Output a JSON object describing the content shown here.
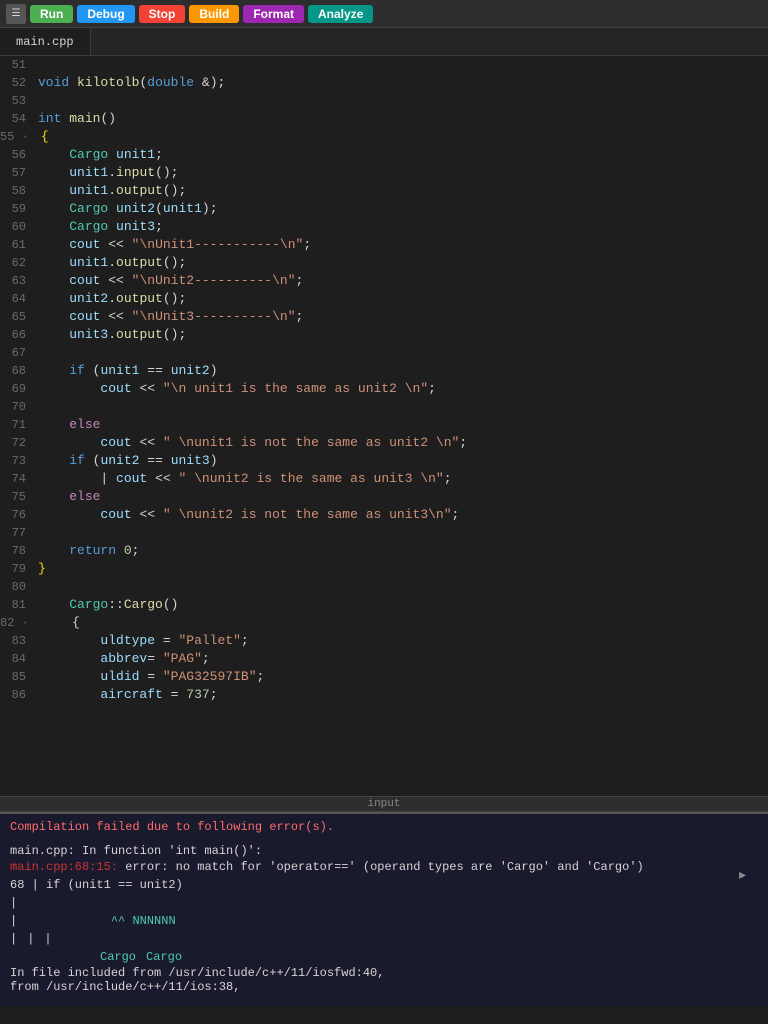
{
  "toolbar": {
    "tab_label": "main.cpp",
    "buttons": [
      "Run",
      "Debug",
      "Stop",
      "Build",
      "Format",
      "Analyze"
    ]
  },
  "editor": {
    "lines": [
      {
        "num": "51",
        "tokens": []
      },
      {
        "num": "52",
        "text": "void kilotolb(double &);"
      },
      {
        "num": "53",
        "tokens": []
      },
      {
        "num": "54",
        "text": "int main()"
      },
      {
        "num": "55",
        "text": "{"
      },
      {
        "num": "56",
        "text": "    Cargo unit1;"
      },
      {
        "num": "57",
        "text": "    unit1.input();"
      },
      {
        "num": "58",
        "text": "    unit1.output();"
      },
      {
        "num": "59",
        "text": "    Cargo unit2(unit1);"
      },
      {
        "num": "60",
        "text": "    Cargo unit3;"
      },
      {
        "num": "61",
        "text": "    cout << \"\\nUnit1-----------\\n\";"
      },
      {
        "num": "62",
        "text": "    unit1.output();"
      },
      {
        "num": "63",
        "text": "    cout << \"\\nUnit2----------\\n\";"
      },
      {
        "num": "64",
        "text": "    unit2.output();"
      },
      {
        "num": "65",
        "text": "    cout << \"\\nUnit3----------\\n\";"
      },
      {
        "num": "66",
        "text": "    unit3.output();"
      },
      {
        "num": "67",
        "tokens": []
      },
      {
        "num": "68",
        "text": "    if (unit1 == unit2)"
      },
      {
        "num": "69",
        "text": "        cout << \"\\n unit1 is the same as unit2 \\n\";"
      },
      {
        "num": "70",
        "tokens": []
      },
      {
        "num": "71",
        "text": "    else"
      },
      {
        "num": "72",
        "text": "        cout << \" \\nunit1 is not the same as unit2 \\n\";"
      },
      {
        "num": "73",
        "text": "    if (unit2 == unit3)"
      },
      {
        "num": "74",
        "text": "        | cout << \" \\nunit2 is the same as unit3 \\n\";"
      },
      {
        "num": "75",
        "text": "    else"
      },
      {
        "num": "76",
        "text": "        cout << \" \\nunit2 is not the same as unit3\\n\";"
      },
      {
        "num": "77",
        "tokens": []
      },
      {
        "num": "78",
        "text": "    return 0;"
      },
      {
        "num": "79",
        "text": "}"
      },
      {
        "num": "80",
        "tokens": []
      },
      {
        "num": "81",
        "text": "    Cargo::Cargo()"
      },
      {
        "num": "82",
        "text": "    {"
      },
      {
        "num": "83",
        "text": "        uldtype = \"Pallet\";"
      },
      {
        "num": "84",
        "text": "        abbrev= \"PAG\";"
      },
      {
        "num": "85",
        "text": "        uldid = \"PAG32597IB\";"
      },
      {
        "num": "86",
        "text": "        aircraft = 737;"
      }
    ]
  },
  "scrollbar": {
    "label": "input"
  },
  "bottom": {
    "compilation_status": "Compilation failed due to following error(s).",
    "error_fn": "main.cpp: In function 'int main()':",
    "error_loc": "main.cpp:68:15:",
    "error_desc": " error: no match for 'operator==' (operand types are 'Cargo' and 'Cargo')",
    "error_code": "   68 |      if (unit1 == unit2)",
    "error_pipe1": "      |",
    "error_pipe2": "      |",
    "error_pipe3": "      |",
    "error_cargo1": "         Cargo",
    "error_cargo2": "   Cargo",
    "error_inc1": "In file included from /usr/include/c++/11/iosfwd:40,",
    "error_inc2": "                 from /usr/include/c++/11/ios:38,"
  }
}
